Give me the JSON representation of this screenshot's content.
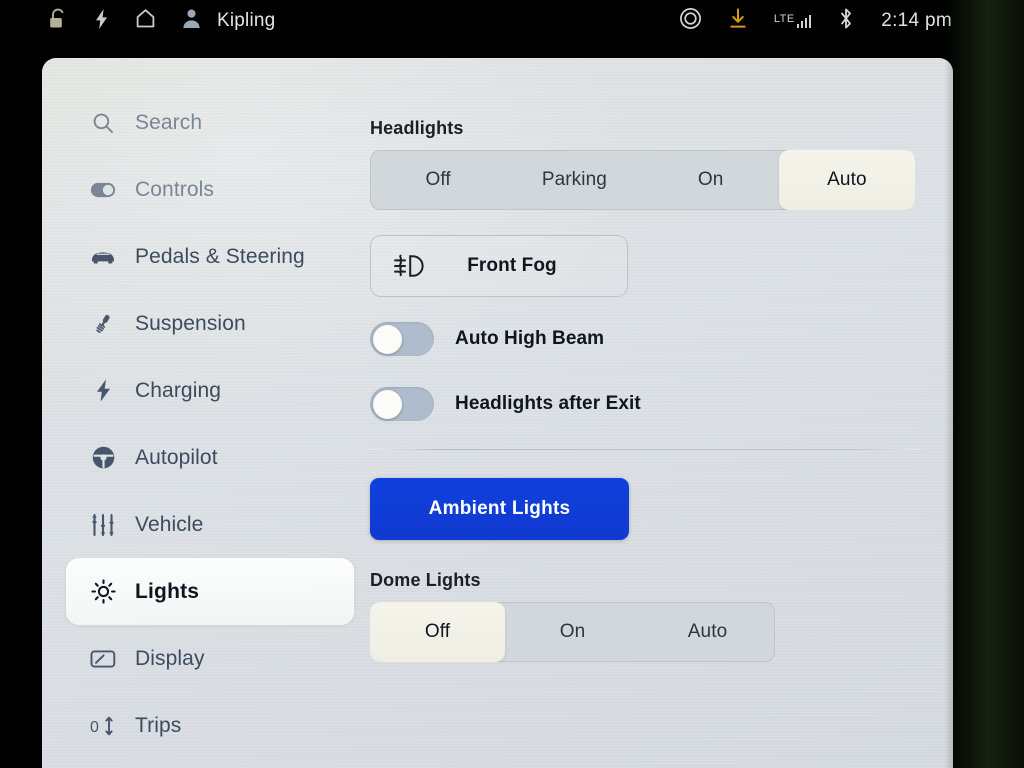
{
  "status_bar": {
    "icons_left": [
      "unlock-icon",
      "bolt-icon",
      "home-icon",
      "person-icon"
    ],
    "driver_name": "Kipling",
    "icons_right": [
      "circle-target-icon",
      "download-icon",
      "lte-signal-icon",
      "bluetooth-icon"
    ],
    "network_label": "LTE",
    "signal_bars": 4,
    "clock": "2:14 pm",
    "download_color": "#d99a15"
  },
  "sidebar": {
    "items": [
      {
        "label": "Search",
        "icon": "search-icon",
        "state": "muted",
        "selected": false
      },
      {
        "label": "Controls",
        "icon": "toggle-icon",
        "state": "muted",
        "selected": false
      },
      {
        "label": "Pedals & Steering",
        "icon": "car-icon",
        "state": "normal",
        "selected": false
      },
      {
        "label": "Suspension",
        "icon": "shock-absorber-icon",
        "state": "normal",
        "selected": false
      },
      {
        "label": "Charging",
        "icon": "bolt-icon",
        "state": "normal",
        "selected": false
      },
      {
        "label": "Autopilot",
        "icon": "steering-wheel-icon",
        "state": "normal",
        "selected": false
      },
      {
        "label": "Vehicle",
        "icon": "sliders-icon",
        "state": "normal",
        "selected": false
      },
      {
        "label": "Lights",
        "icon": "sun-brightness-icon",
        "state": "normal",
        "selected": true
      },
      {
        "label": "Display",
        "icon": "display-icon",
        "state": "normal",
        "selected": false
      },
      {
        "label": "Trips",
        "icon": "odometer-icon",
        "state": "normal",
        "selected": false
      }
    ]
  },
  "content": {
    "headlights": {
      "title": "Headlights",
      "options": [
        "Off",
        "Parking",
        "On",
        "Auto"
      ],
      "selected": "Auto"
    },
    "front_fog": {
      "label": "Front Fog",
      "icon": "front-fog-light-icon",
      "active": false
    },
    "toggles": [
      {
        "label": "Auto High Beam",
        "value": "off"
      },
      {
        "label": "Headlights after Exit",
        "value": "off"
      }
    ],
    "ambient_lights": {
      "label": "Ambient Lights",
      "accent_color": "#1139cf"
    },
    "dome_lights": {
      "title": "Dome Lights",
      "options": [
        "Off",
        "On",
        "Auto"
      ],
      "selected": "Off"
    }
  }
}
